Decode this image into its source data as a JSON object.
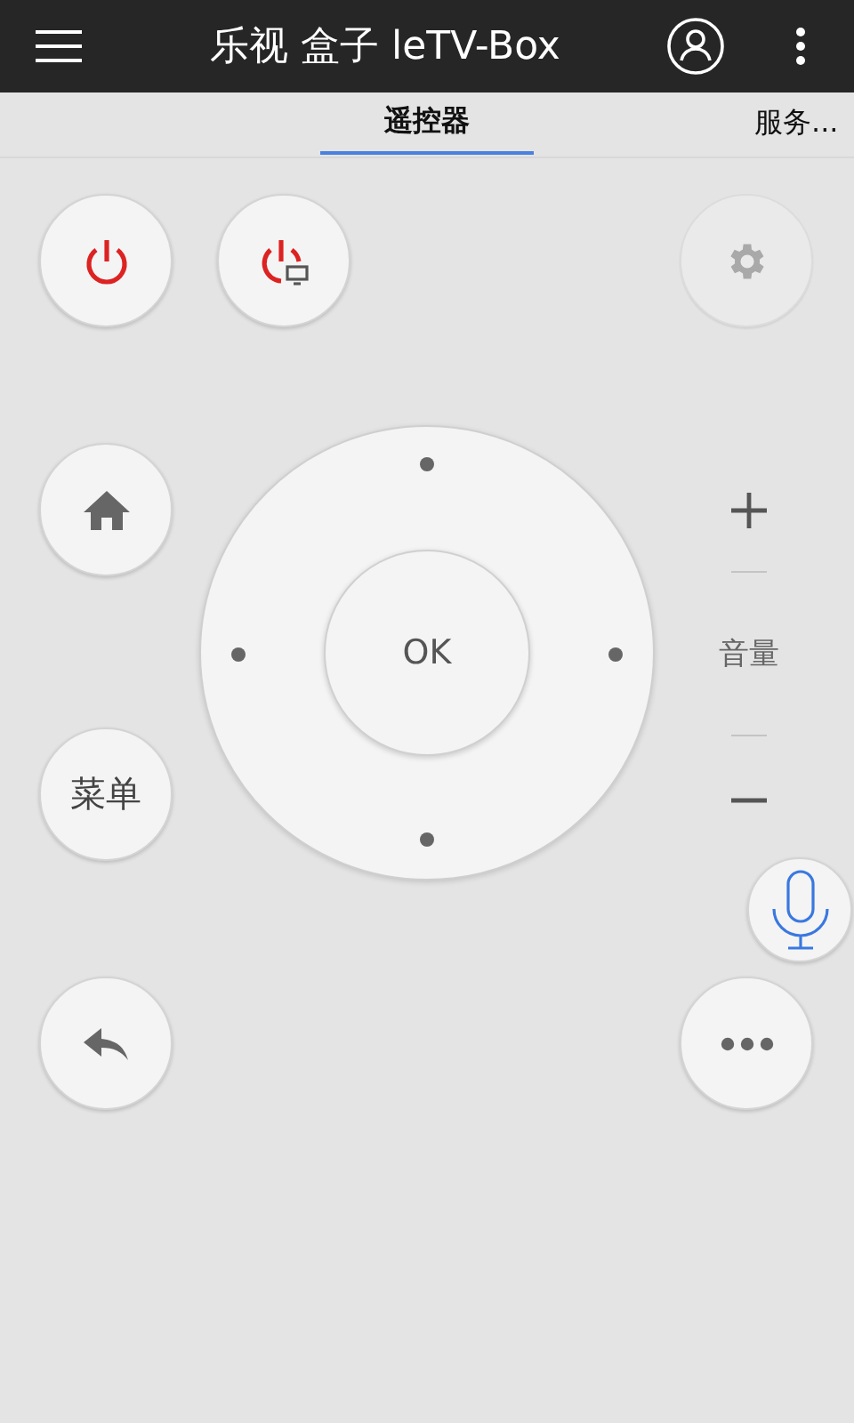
{
  "app_bar": {
    "title": "乐视 盒子 leTV-Box"
  },
  "tabs": [
    {
      "label": "遥控器",
      "selected": true
    },
    {
      "label": "服务...",
      "selected": false
    }
  ],
  "keys": [
    {
      "kind": "power",
      "disabled": false
    },
    {
      "kind": "screen_power",
      "disabled": false
    },
    {
      "kind": "settings",
      "disabled": true
    },
    {
      "kind": "home",
      "disabled": false
    },
    {
      "kind": "menu",
      "label": "菜单",
      "disabled": false
    },
    {
      "kind": "back",
      "disabled": false
    },
    {
      "kind": "voice",
      "disabled": false
    },
    {
      "kind": "more",
      "disabled": false
    }
  ],
  "dpad": {
    "center_label": "OK"
  },
  "volume": {
    "label": "音量"
  }
}
